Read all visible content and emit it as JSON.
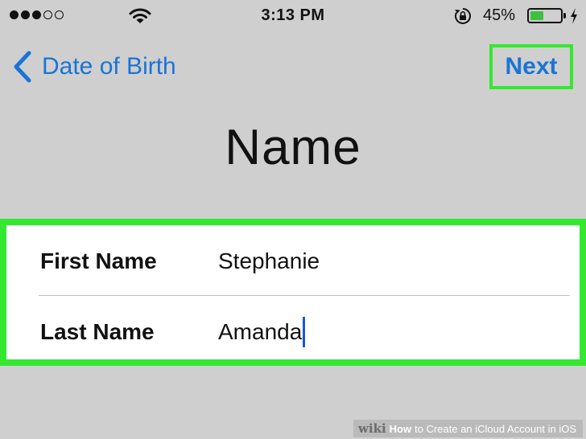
{
  "status_bar": {
    "signal_filled": 3,
    "signal_total": 5,
    "time": "3:13 PM",
    "battery_percent_text": "45%",
    "battery_level": 0.45,
    "battery_color": "#3fbf3f",
    "icons": [
      "wifi-icon",
      "rotation-lock-icon",
      "charging-bolt-icon"
    ]
  },
  "nav": {
    "back_label": "Date of Birth",
    "next_label": "Next",
    "accent_color": "#1a74d6",
    "highlight_color": "#34e82f"
  },
  "page": {
    "title": "Name"
  },
  "form": {
    "fields": [
      {
        "label": "First Name",
        "value": "Stephanie"
      },
      {
        "label": "Last Name",
        "value": "Amanda"
      }
    ]
  },
  "watermark": {
    "logo": "wiki",
    "howto": "How",
    "title": "to Create an iCloud Account in iOS"
  }
}
